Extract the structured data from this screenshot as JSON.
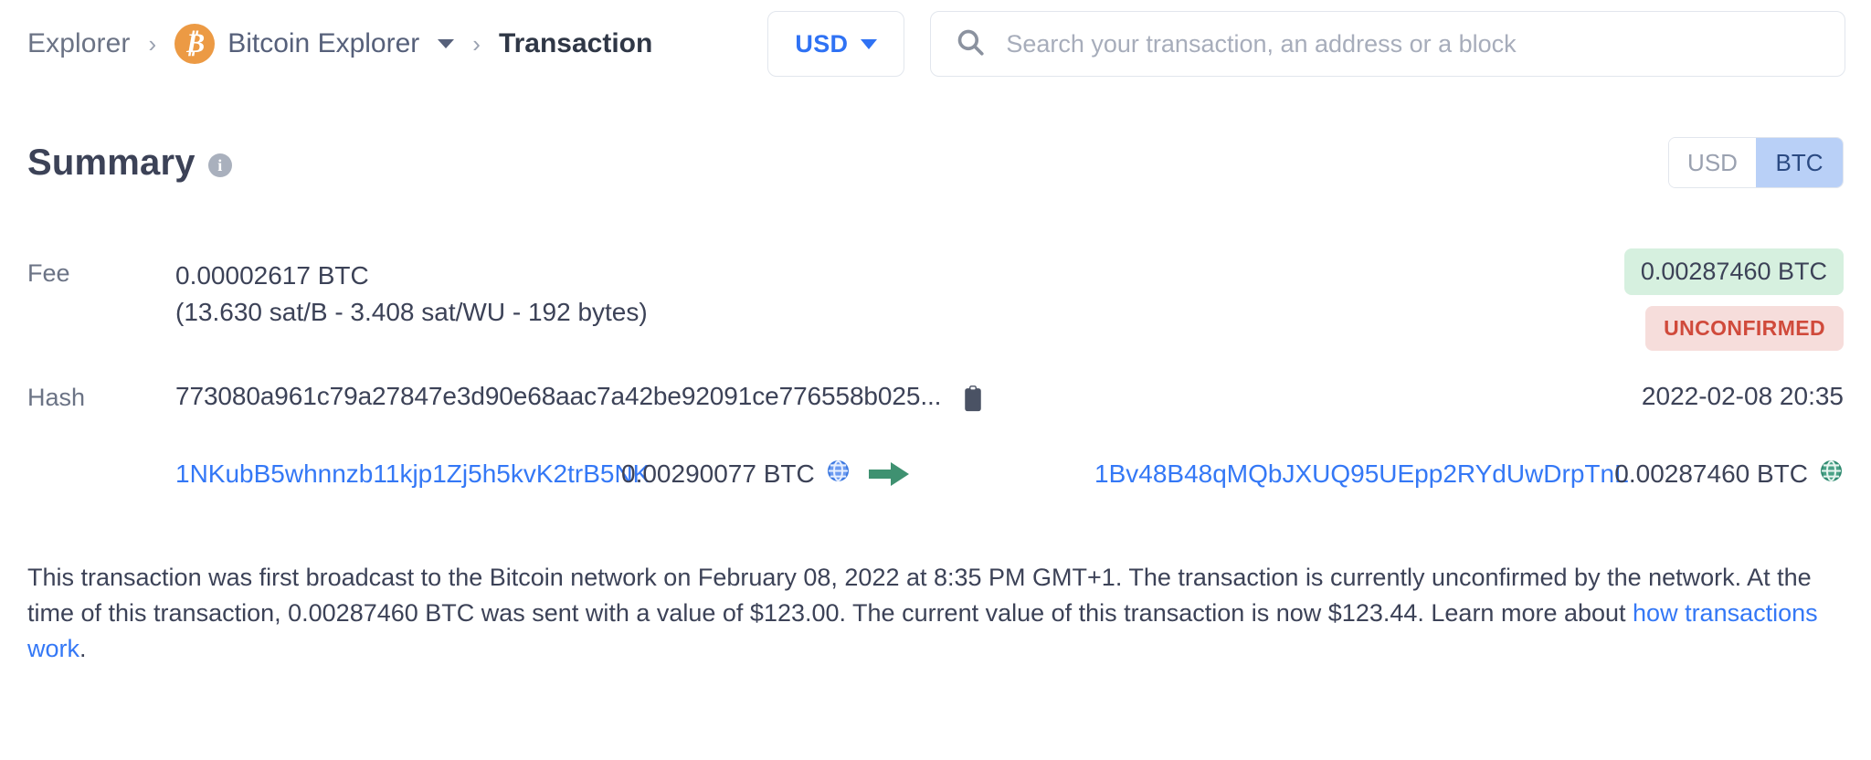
{
  "header": {
    "breadcrumb": {
      "explorer_label": "Explorer",
      "separator": "›",
      "bitcoin_label": "Bitcoin Explorer",
      "bitcoin_symbol": "₿",
      "current_label": "Transaction"
    },
    "currency_select": {
      "value": "USD"
    },
    "search": {
      "placeholder": "Search your transaction, an address or a block",
      "value": ""
    }
  },
  "summary": {
    "title": "Summary",
    "info_glyph": "i",
    "unit_toggle": {
      "options": [
        "USD",
        "BTC"
      ],
      "selected": "BTC"
    }
  },
  "fee": {
    "label": "Fee",
    "amount": "0.00002617 BTC",
    "rates": "(13.630 sat/B - 3.408 sat/WU - 192 bytes)",
    "badge_amount": "0.00287460 BTC",
    "badge_status": "UNCONFIRMED"
  },
  "hash": {
    "label": "Hash",
    "value": "773080a961c79a27847e3d90e68aac7a42be92091ce776558b025...",
    "copy_icon": "clipboard-icon",
    "timestamp": "2022-02-08 20:35"
  },
  "io": {
    "input_address": "1NKubB5whnnzb11kjp1Zj5h5kvK2trB5NK",
    "input_amount": "0.00290077 BTC",
    "input_globe_icon": "globe-icon",
    "arrow_icon": "arrow-right-icon",
    "output_address": "1Bv48B48qMQbJXUQ95UEpp2RYdUwDrpTnL",
    "output_amount": "0.00287460 BTC",
    "output_globe_icon": "globe-icon"
  },
  "footer": {
    "text_before_link": "This transaction was first broadcast to the Bitcoin network on February 08, 2022 at 8:35 PM GMT+1.  The transaction is currently unconfirmed by the network.  At the time of this transaction, 0.00287460 BTC was sent with a value of $123.00. The current value of this transaction is now $123.44.  Learn more about ",
    "link_text": "how transactions work",
    "text_after_link": "."
  },
  "colors": {
    "accent_blue": "#3478f6",
    "bitcoin_orange": "#ec9a44",
    "badge_green_bg": "#d6f0df",
    "badge_red_bg": "#f6dddb",
    "badge_red_text": "#d04a3b",
    "toggle_active_bg": "#b9d0f7",
    "globe_green": "#35937a",
    "arrow_green": "#3f9171"
  }
}
